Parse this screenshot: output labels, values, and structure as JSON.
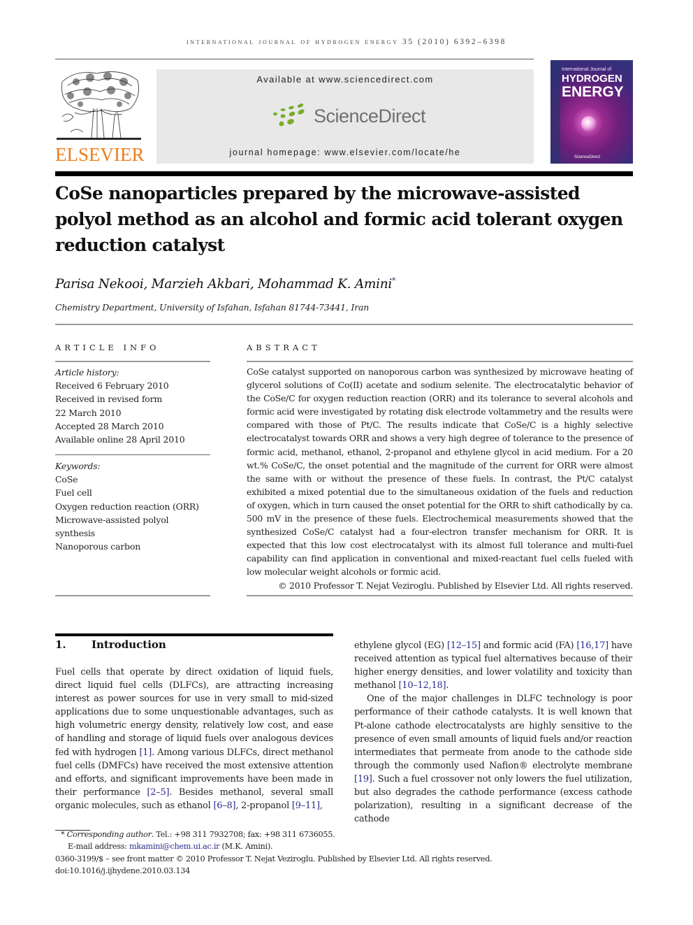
{
  "header": {
    "running_head": "INTERNATIONAL JOURNAL OF HYDROGEN ENERGY 35 (2010) 6392–6398",
    "publisher_logo_text": "ELSEVIER",
    "available_at": "Available at www.sciencedirect.com",
    "sciencedirect_logo_text": "ScienceDirect",
    "journal_homepage": "journal homepage: www.elsevier.com/locate/he",
    "cover": {
      "line1": "International Journal of",
      "line2": "HYDROGEN",
      "line3": "ENERGY",
      "footer": "ScienceDirect"
    },
    "colors": {
      "elsevier_orange": "#f07d1b",
      "sd_green": "#7aab2a",
      "sd_grey": "#707070",
      "link_blue": "#2a2a8a"
    }
  },
  "article": {
    "title": "CoSe nanoparticles prepared by the microwave-assisted polyol method as an alcohol and formic acid tolerant oxygen reduction catalyst",
    "authors": "Parisa Nekooi, Marzieh Akbari, Mohammad K. Amini",
    "corresponding_mark": "*",
    "affiliation": "Chemistry Department, University of Isfahan, Isfahan 81744-73441, Iran"
  },
  "article_info": {
    "heading": "ARTICLE INFO",
    "history_label": "Article history:",
    "history": [
      "Received 6 February 2010",
      "Received in revised form",
      "22 March 2010",
      "Accepted 28 March 2010",
      "Available online 28 April 2010"
    ],
    "keywords_label": "Keywords:",
    "keywords": [
      "CoSe",
      "Fuel cell",
      "Oxygen reduction reaction (ORR)",
      "Microwave-assisted polyol",
      "synthesis",
      "Nanoporous carbon"
    ]
  },
  "abstract": {
    "heading": "ABSTRACT",
    "text": "CoSe catalyst supported on nanoporous carbon was synthesized by microwave heating of glycerol solutions of Co(II) acetate and sodium selenite. The electrocatalytic behavior of the CoSe/C for oxygen reduction reaction (ORR) and its tolerance to several alcohols and formic acid were investigated by rotating disk electrode voltammetry and the results were compared with those of Pt/C. The results indicate that CoSe/C is a highly selective electrocatalyst towards ORR and shows a very high degree of tolerance to the presence of formic acid, methanol, ethanol, 2-propanol and ethylene glycol in acid medium. For a 20 wt.% CoSe/C, the onset potential and the magnitude of the current for ORR were almost the same with or without the presence of these fuels. In contrast, the Pt/C catalyst exhibited a mixed potential due to the simultaneous oxidation of the fuels and reduction of oxygen, which in turn caused the onset potential for the ORR to shift cathodically by ca. 500 mV in the presence of these fuels. Electrochemical measurements showed that the synthesized CoSe/C catalyst had a four-electron transfer mechanism for ORR. It is expected that this low cost electrocatalyst with its almost full tolerance and multi-fuel capability can find application in conventional and mixed-reactant fuel cells fueled with low molecular weight alcohols or formic acid.",
    "copyright": "© 2010 Professor T. Nejat Veziroglu. Published by Elsevier Ltd. All rights reserved."
  },
  "introduction": {
    "number": "1.",
    "heading": "Introduction",
    "left_col": {
      "t1": "Fuel cells that operate by direct oxidation of liquid fuels, direct liquid fuel cells (DLFCs), are attracting increasing interest as power sources for use in very small to mid-sized applications due to some unquestionable advantages, such as high volumetric energy density, relatively low cost, and ease of handling and storage of liquid fuels over analogous devices fed with hydrogen ",
      "r1": "[1]",
      "t2": ". Among various DLFCs, direct methanol fuel cells (DMFCs) have received the most extensive attention and efforts, and significant improvements have been made in their performance ",
      "r2": "[2–5]",
      "t3": ". Besides methanol, several small organic molecules, such as ethanol ",
      "r3": "[6–8]",
      "t4": ", 2-propanol ",
      "r4": "[9–11]",
      "t5": ","
    },
    "right_col": {
      "p1": {
        "t1": "ethylene glycol (EG) ",
        "r1": "[12–15]",
        "t2": " and formic acid (FA) ",
        "r2": "[16,17]",
        "t3": " have received attention as typical fuel alternatives because of their higher energy densities, and lower volatility and toxicity than methanol ",
        "r3": "[10–12,18]",
        "t4": "."
      },
      "p2": {
        "t1": "One of the major challenges in DLFC technology is poor performance of their cathode catalysts. It is well known that Pt-alone cathode electrocatalysts are highly sensitive to the presence of even small amounts of liquid fuels and/or reaction intermediates that permeate from anode to the cathode side through the commonly used Nafion® electrolyte membrane ",
        "r1": "[19]",
        "t2": ". Such a fuel crossover not only lowers the fuel utilization, but also degrades the cathode performance (excess cathode polarization), resulting in a significant decrease of the cathode"
      }
    }
  },
  "footnotes": {
    "mark": "*",
    "corresponding_label": "Corresponding author",
    "contact": ". Tel.: +98 311 7932708; fax: +98 311 6736055.",
    "email_label": "E-mail address: ",
    "email": "mkamini@chem.ui.ac.ir",
    "email_suffix": " (M.K. Amini).",
    "issn_line": "0360-3199/$ – see front matter © 2010 Professor T. Nejat Veziroglu. Published by Elsevier Ltd. All rights reserved.",
    "doi": "doi:10.1016/j.ijhydene.2010.03.134"
  }
}
